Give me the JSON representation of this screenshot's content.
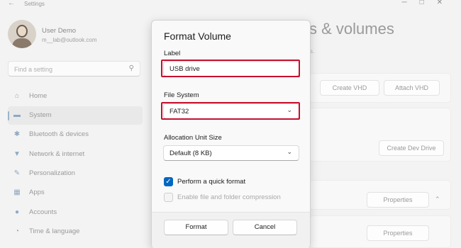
{
  "window": {
    "app_title": "Settings",
    "back_icon": "back-arrow-icon"
  },
  "profile": {
    "name": "User Demo",
    "email": "m__lab@outlook.com"
  },
  "search": {
    "placeholder": "Find a setting",
    "icon": "search-icon"
  },
  "nav": {
    "items": [
      {
        "label": "Home",
        "icon": "home-icon",
        "active": false
      },
      {
        "label": "System",
        "icon": "monitor-icon",
        "active": true
      },
      {
        "label": "Bluetooth & devices",
        "icon": "bluetooth-icon",
        "active": false
      },
      {
        "label": "Network & internet",
        "icon": "wifi-icon",
        "active": false
      },
      {
        "label": "Personalization",
        "icon": "brush-icon",
        "active": false
      },
      {
        "label": "Apps",
        "icon": "apps-icon",
        "active": false
      },
      {
        "label": "Accounts",
        "icon": "person-icon",
        "active": false
      },
      {
        "label": "Time & language",
        "icon": "globe-clock-icon",
        "active": false
      }
    ]
  },
  "page": {
    "title_fragment": "ks & volumes",
    "subtitle_fragment": "mes."
  },
  "background_buttons": {
    "create_vhd": "Create VHD",
    "attach_vhd": "Attach VHD",
    "create_dev_drive": "Create Dev Drive",
    "properties": "Properties"
  },
  "dialog": {
    "title": "Format Volume",
    "label_caption": "Label",
    "label_value": "USB drive",
    "filesystem_caption": "File System",
    "filesystem_value": "FAT32",
    "allocation_caption": "Allocation Unit Size",
    "allocation_value": "Default (8 KB)",
    "quick_format_label": "Perform a quick format",
    "quick_format_checked": true,
    "compression_label": "Enable file and folder compression",
    "compression_checked": false,
    "compression_enabled": false,
    "format_button": "Format",
    "cancel_button": "Cancel"
  },
  "colors": {
    "accent": "#0067c0",
    "highlight_box": "#c8102e"
  }
}
